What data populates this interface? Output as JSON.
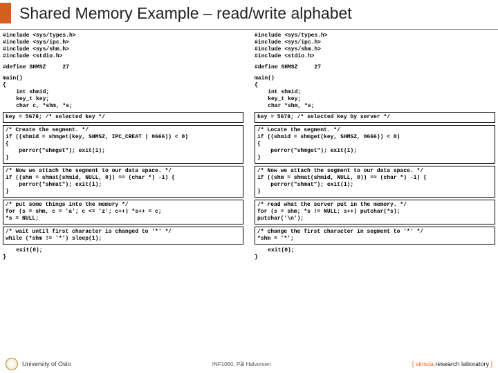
{
  "title": "Shared Memory Example – read/write alphabet",
  "left": {
    "includes": "#include <sys/types.h>\n#include <sys/ipc.h>\n#include <sys/shm.h>\n#include <stdio.h>",
    "define": "#define SHMSZ     27",
    "main_open": "main()\n{\n    int shmid;\n    key_t key;\n    char c, *shm, *s;",
    "box1": "key = 5678; /* selected key */",
    "box2": "/* Create the segment. */\nif ((shmid = shmget(key, SHMSZ, IPC_CREAT | 0666)) < 0)\n{\n    perror(\"shmget\"); exit(1);\n}",
    "box3": "/* Now we attach the segment to our data space. */\nif ((shm = shmat(shmid, NULL, 0)) == (char *) -1) {\n    perror(\"shmat\"); exit(1);\n}",
    "box4": "/* put some things into the memory */\nfor (s = shm, c = 'a'; c <= 'z'; c++) *s++ = c;\n*s = NULL;",
    "box5": "/* wait until first character is changed to '*' */\nwhile (*shm != '*') sleep(1);",
    "exit": "    exit(0);\n}"
  },
  "right": {
    "includes": "#include <sys/types.h>\n#include <sys/ipc.h>\n#include <sys/shm.h>\n#include <stdio.h>",
    "define": "#define SHMSZ     27",
    "main_open": "main()\n{\n    int shmid;\n    key_t key;\n    char *shm, *s;",
    "box1": "key = 5678; /* selected key by server */",
    "box2": "/* Locate the segment. */\nif ((shmid = shmget(key, SHMSZ, 0666)) < 0)\n{\n    perror(\"shmget\"); exit(1);\n}",
    "box3": "/* Now we attach the segment to our data space. */\nif ((shm = shmat(shmid, NULL, 0)) == (char *) -1) {\n    perror(\"shmat\"); exit(1);\n}",
    "box4": "/* read what the server put in the memory. */\nfor (s = shm; *s != NULL; s++) putchar(*s);\nputchar('\\n');",
    "box5": "/* change the first character in segment to '*' */\n*shm = '*';",
    "exit": "    exit(0);\n}"
  },
  "footer": {
    "uni": "University of Oslo",
    "center": "INF1060, Pål Halvorsen",
    "right_brand": "simula",
    "right_rest": ".research laboratory"
  }
}
